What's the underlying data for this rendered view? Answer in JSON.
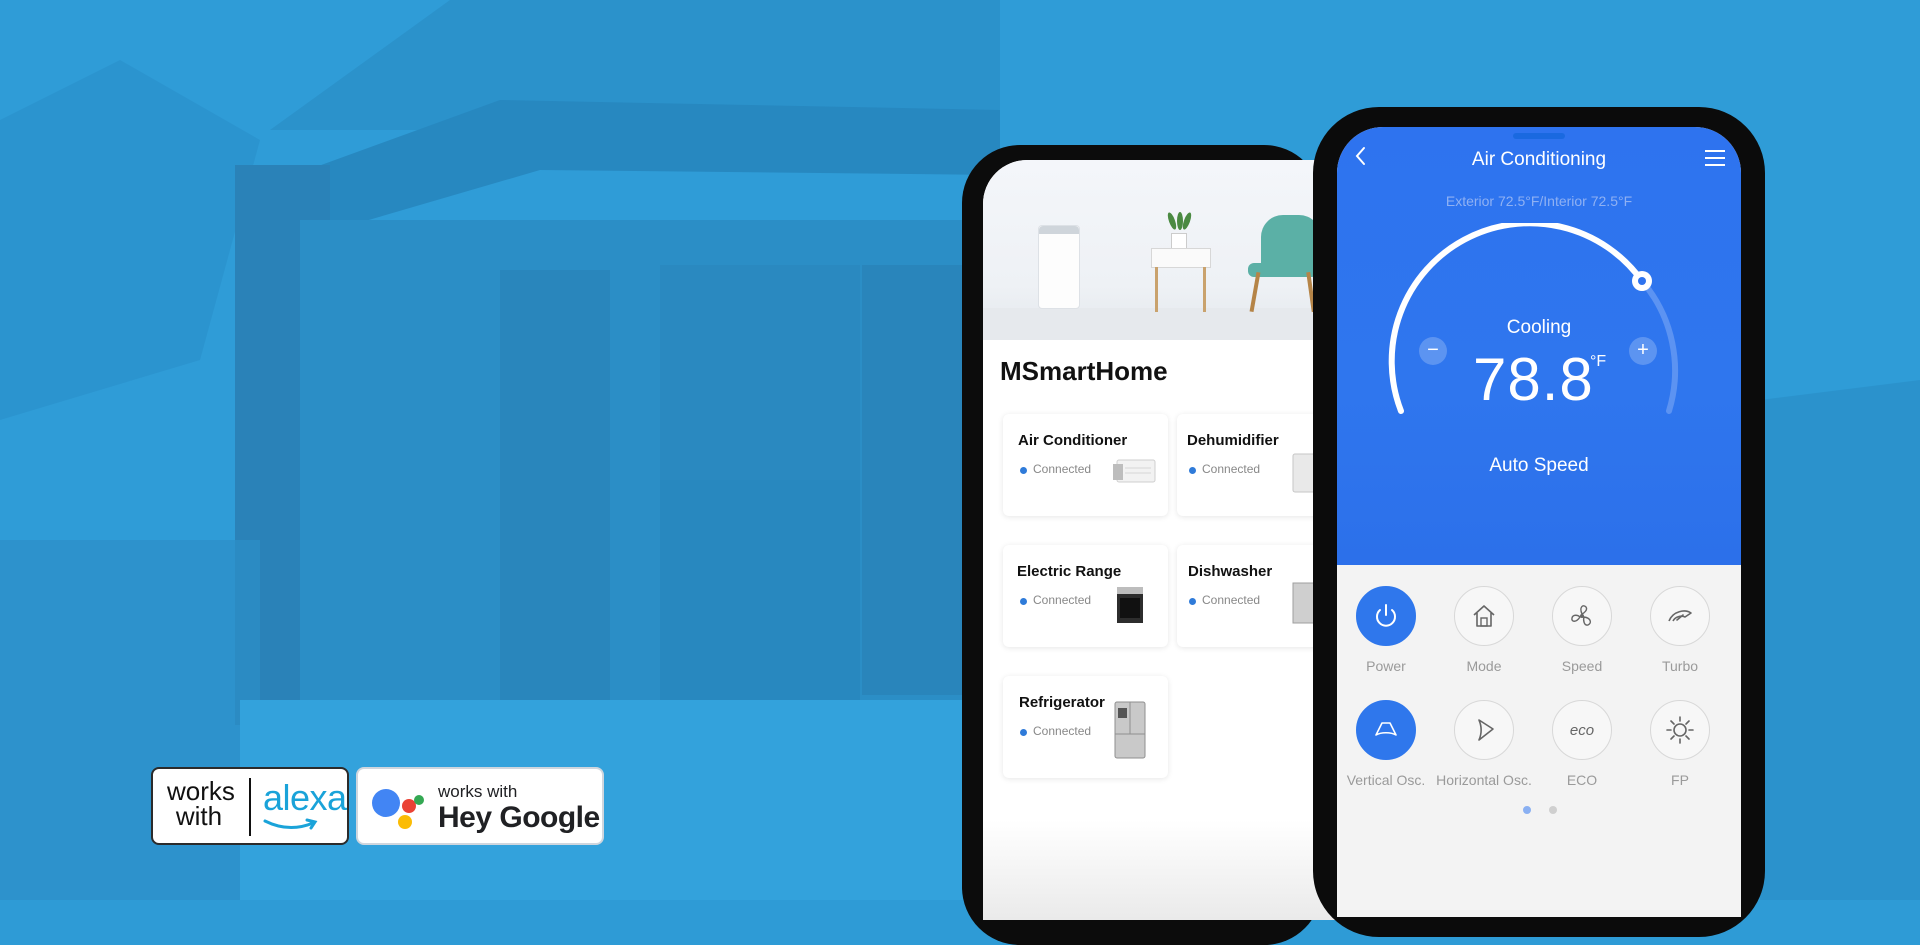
{
  "badges": {
    "alexa": {
      "works_line1": "works",
      "works_line2": "with",
      "brand": "alexa"
    },
    "google": {
      "works": "works with",
      "hey": "Hey Google"
    }
  },
  "home_app": {
    "title": "MSmartHome",
    "devices": [
      {
        "name": "Air Conditioner",
        "status": "Connected"
      },
      {
        "name": "Dehumidifier",
        "status": "Connected"
      },
      {
        "name": "Electric Range",
        "status": "Connected"
      },
      {
        "name": "Dishwasher",
        "status": "Connected"
      },
      {
        "name": "Refrigerator",
        "status": "Connected"
      }
    ]
  },
  "ac_app": {
    "title": "Air Conditioning",
    "subtitle": "Exterior 72.5°F/Interior 72.5°F",
    "mode": "Cooling",
    "temperature": "78.8",
    "unit": "°F",
    "fan": "Auto Speed",
    "controls": [
      {
        "label": "Power",
        "icon": "power-icon",
        "active": true
      },
      {
        "label": "Mode",
        "icon": "home-icon",
        "active": false
      },
      {
        "label": "Speed",
        "icon": "fan-icon",
        "active": false
      },
      {
        "label": "Turbo",
        "icon": "turbo-icon",
        "active": false
      },
      {
        "label": "Vertical Osc.",
        "icon": "vertical-osc-icon",
        "active": true
      },
      {
        "label": "Horizontal Osc.",
        "icon": "horizontal-osc-icon",
        "active": false
      },
      {
        "label": "ECO",
        "icon": "eco-icon",
        "active": false
      },
      {
        "label": "FP",
        "icon": "sun-icon",
        "active": false
      }
    ],
    "page_indicator": {
      "current": 1,
      "total": 2
    }
  },
  "colors": {
    "background": "#2e9bd6",
    "accent_blue": "#2f77ec",
    "alexa_blue": "#1aa3d9",
    "google_blue": "#4285f4",
    "google_red": "#ea4335",
    "google_yellow": "#fbbc05",
    "google_green": "#34a853"
  }
}
